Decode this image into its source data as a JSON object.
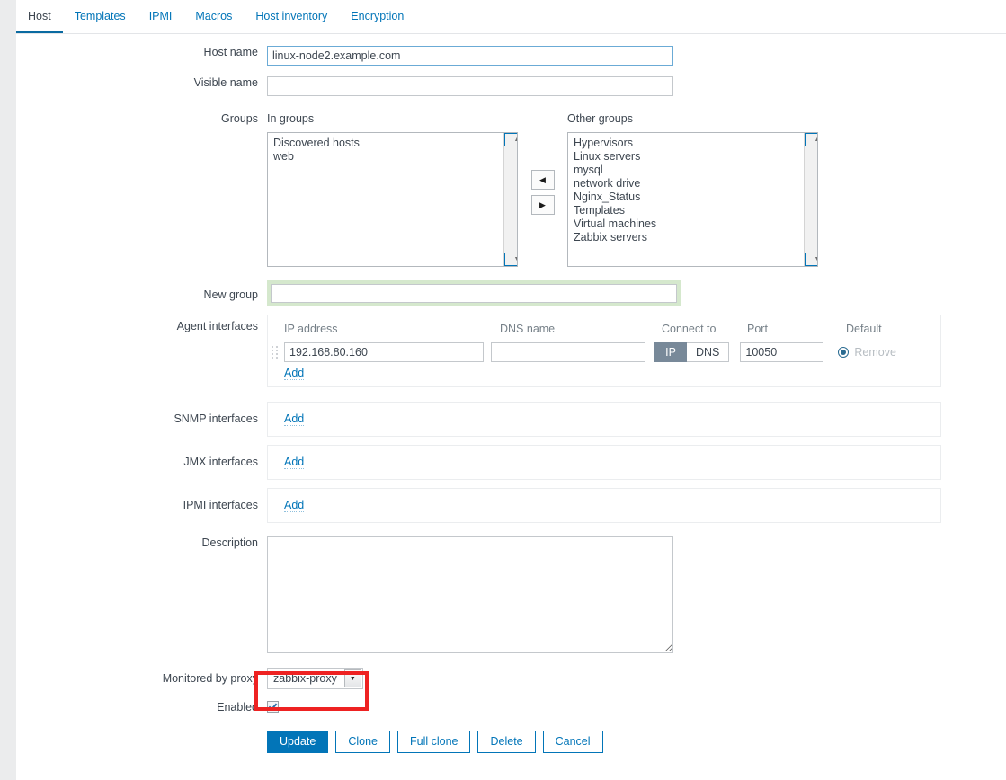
{
  "tabs": [
    {
      "label": "Host",
      "active": true
    },
    {
      "label": "Templates",
      "active": false
    },
    {
      "label": "IPMI",
      "active": false
    },
    {
      "label": "Macros",
      "active": false
    },
    {
      "label": "Host inventory",
      "active": false
    },
    {
      "label": "Encryption",
      "active": false
    }
  ],
  "form": {
    "host_name": {
      "label": "Host name",
      "value": "linux-node2.example.com"
    },
    "visible_name": {
      "label": "Visible name",
      "value": ""
    },
    "groups": {
      "label": "Groups",
      "in_groups_caption": "In groups",
      "in_groups": [
        "Discovered hosts",
        "web"
      ],
      "other_groups_caption": "Other groups",
      "other_groups": [
        "Hypervisors",
        "Linux servers",
        "mysql",
        "network drive",
        "Nginx_Status",
        "Templates",
        "Virtual machines",
        "Zabbix servers"
      ],
      "move_left_icon": "arrow-left-icon",
      "move_right_icon": "arrow-right-icon"
    },
    "new_group": {
      "label": "New group",
      "value": ""
    },
    "agent_interfaces": {
      "label": "Agent interfaces",
      "columns": {
        "ip": "IP address",
        "dns": "DNS name",
        "connect_to": "Connect to",
        "port": "Port",
        "default": "Default"
      },
      "rows": [
        {
          "ip": "192.168.80.160",
          "dns": "",
          "connect_ip": "IP",
          "connect_dns": "DNS",
          "connect_selected": "IP",
          "port": "10050",
          "remove": "Remove"
        }
      ],
      "add_label": "Add"
    },
    "snmp_interfaces": {
      "label": "SNMP interfaces",
      "add_label": "Add"
    },
    "jmx_interfaces": {
      "label": "JMX interfaces",
      "add_label": "Add"
    },
    "ipmi_interfaces": {
      "label": "IPMI interfaces",
      "add_label": "Add"
    },
    "description": {
      "label": "Description",
      "value": ""
    },
    "monitored_by_proxy": {
      "label": "Monitored by proxy",
      "value": "zabbix-proxy",
      "arrow_icon": "chevron-down-icon"
    },
    "enabled": {
      "label": "Enabled",
      "checked": true
    }
  },
  "buttons": {
    "update": "Update",
    "clone": "Clone",
    "full_clone": "Full clone",
    "delete": "Delete",
    "cancel": "Cancel"
  },
  "colors": {
    "accent": "#0275b8",
    "tab_active_underline": "#0a6aa1",
    "highlight_green": "#d5e8cd",
    "annotation_red": "#ee2222",
    "toggle_selected": "#788999"
  }
}
